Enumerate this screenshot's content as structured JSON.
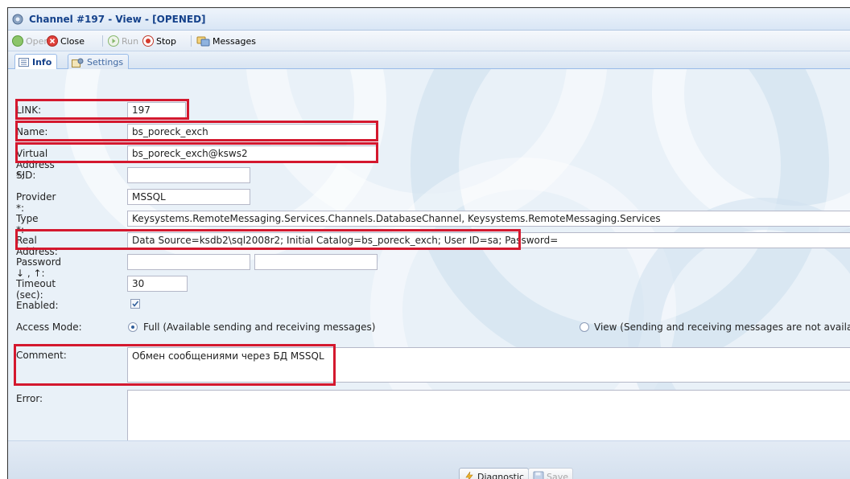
{
  "window": {
    "title": "Channel #197 - View - [OPENED]"
  },
  "toolbar": {
    "open_label": "Open",
    "close_label": "Close",
    "run_label": "Run",
    "stop_label": "Stop",
    "messages_label": "Messages"
  },
  "tabs": [
    {
      "label": "Info",
      "active": true
    },
    {
      "label": "Settings",
      "active": false
    }
  ],
  "form": {
    "link": {
      "label": "LINK:",
      "value": "197"
    },
    "name": {
      "label": "Name:",
      "value": "bs_poreck_exch"
    },
    "virtual_address": {
      "label": "Virtual Address *:",
      "value": "bs_poreck_exch@ksws2"
    },
    "sid": {
      "label": "SID:",
      "value": ""
    },
    "provider": {
      "label": "Provider *:",
      "value": "MSSQL"
    },
    "type": {
      "label": "Type *:",
      "value": "Keysystems.RemoteMessaging.Services.Channels.DatabaseChannel, Keysystems.RemoteMessaging.Services"
    },
    "real_address": {
      "label": "Real Address:",
      "value": "Data Source=ksdb2\\sql2008r2; Initial Catalog=bs_poreck_exch; User ID=sa; Password="
    },
    "password": {
      "label": "Password ↓ , ↑:",
      "value1": "",
      "value2": ""
    },
    "timeout": {
      "label": "Timeout (sec):",
      "value": "30"
    },
    "enabled": {
      "label": "Enabled:",
      "checked": true
    },
    "access_mode": {
      "label": "Access Mode:",
      "full_label": "Full (Available sending and receiving messages)",
      "view_label": "View (Sending and receiving messages are not available)",
      "selected": "full"
    },
    "comment": {
      "label": "Comment:",
      "value": "Обмен сообщениями через БД MSSQL"
    },
    "error": {
      "label": "Error:",
      "value": ""
    }
  },
  "footer": {
    "diagnostic_label": "Diagnostic",
    "save_label": "Save"
  },
  "colors": {
    "highlight": "#d4182e",
    "title_text": "#15428b",
    "panel_bg": "#e9f1f8"
  }
}
